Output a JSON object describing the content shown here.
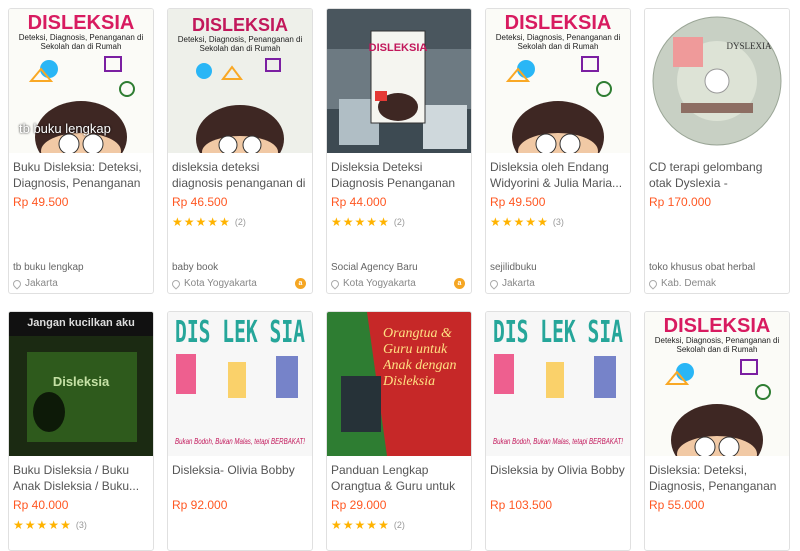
{
  "products": [
    {
      "cover_title": "DISLEKSIA",
      "cover_subtitle": "Deteksi, Diagnosis, Penanganan di Sekolah dan di Rumah",
      "cover_watermark": "tb buku lengkap",
      "title": "Buku Disleksia: Deteksi, Diagnosis, Penanganan di",
      "price": "Rp 49.500",
      "shop": "tb buku lengkap",
      "location": "Jakarta"
    },
    {
      "cover_title": "DISLEKSIA",
      "cover_subtitle": "Deteksi, Diagnosis, Penanganan di Sekolah dan di Rumah",
      "title": "disleksia deteksi diagnosis penanganan di sekolah",
      "price": "Rp 46.500",
      "rating": 5,
      "rating_count": "(2)",
      "shop": "baby book",
      "location": "Kota Yogyakarta",
      "badge": "a"
    },
    {
      "cover_title": "DISLEKSIA",
      "title": "Disleksia Deteksi Diagnosis Penanganan -...",
      "price": "Rp 44.000",
      "rating": 5,
      "rating_count": "(2)",
      "shop": "Social Agency Baru",
      "location": "Kota Yogyakarta",
      "badge": "a"
    },
    {
      "cover_title": "DISLEKSIA",
      "cover_subtitle": "Deteksi, Diagnosis, Penanganan di Sekolah dan di Rumah",
      "title": "Disleksia oleh Endang Widyorini & Julia Maria...",
      "price": "Rp 49.500",
      "rating": 5,
      "rating_count": "(3)",
      "shop": "sejilidbuku",
      "location": "Jakarta"
    },
    {
      "cover_title": "DYSLEXIA",
      "title": "CD terapi gelombang otak Dyslexia - Mengatasi...",
      "price": "Rp 170.000",
      "shop": "toko khusus obat herbal",
      "location": "Kab. Demak"
    },
    {
      "cover_title": "Jangan kucilkan aku",
      "cover_subtitle": "Disleksia",
      "title": "Buku Disleksia / Buku Anak Disleksia / Buku...",
      "price": "Rp 40.000",
      "rating": 5,
      "rating_count": "(3)"
    },
    {
      "cover_title": "DIS LEK SIA",
      "cover_subtitle": "Bukan Bodoh, Bukan Malas, tetapi BERBAKAT!",
      "title": "Disleksia- Olivia Bobby",
      "price": "Rp 92.000"
    },
    {
      "cover_title": "Orangtua & Guru untuk Anak dengan Disleksia",
      "title": "Panduan Lengkap Orangtua & Guru untuk",
      "price": "Rp 29.000",
      "rating": 5,
      "rating_count": "(2)"
    },
    {
      "cover_title": "DIS LEK SIA",
      "cover_subtitle": "Bukan Bodoh, Bukan Malas, tetapi BERBAKAT!",
      "title": "Disleksia by Olivia Bobby",
      "price": "Rp 103.500"
    },
    {
      "cover_title": "DISLEKSIA",
      "cover_subtitle": "Deteksi, Diagnosis, Penanganan di Sekolah dan di Rumah",
      "title": "Disleksia: Deteksi, Diagnosis, Penanganan di",
      "price": "Rp 55.000"
    }
  ],
  "colors": {
    "price": "#ff5722",
    "star": "#ffb300",
    "badge": "#f5a623"
  }
}
